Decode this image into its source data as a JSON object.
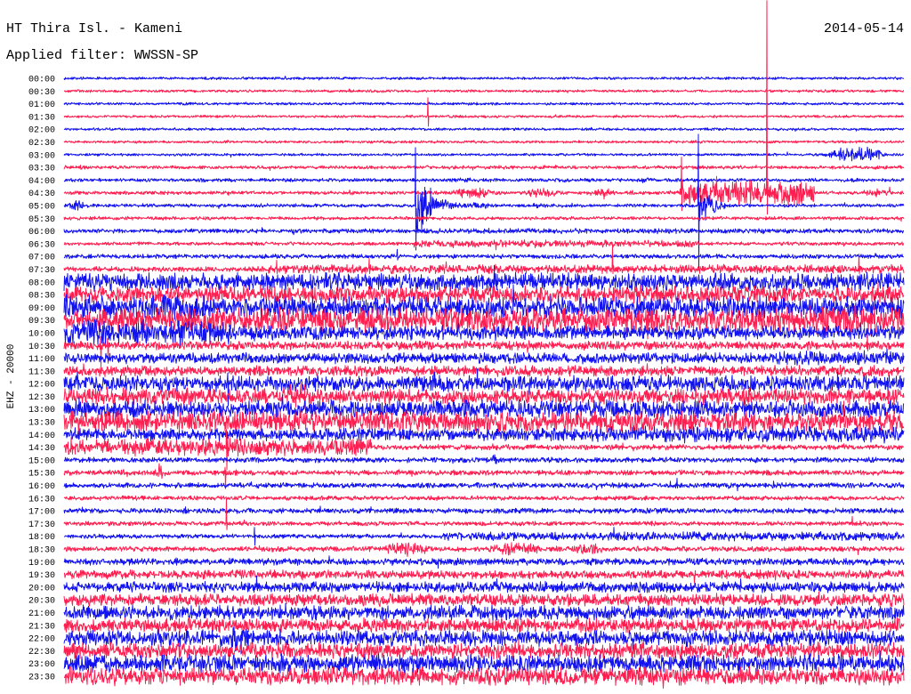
{
  "chart_data": {
    "type": "line",
    "title": "HT Thira Isl. - Kameni",
    "date": "2014-05-14",
    "subtitle": "Applied filter: WWSSN-SP",
    "ylabel": "EHZ - 20000",
    "xlim": [
      0,
      30
    ],
    "colors": [
      "#1212f0",
      "#ff1e50"
    ],
    "rows": [
      {
        "time": "00:00",
        "noise": 2100
      },
      {
        "time": "00:30",
        "noise": 2100
      },
      {
        "time": "01:00",
        "noise": 2100
      },
      {
        "time": "01:30",
        "noise": 2100,
        "events": [
          {
            "t": 13.0,
            "up": 29400,
            "down": 15400,
            "coda": 4200,
            "dur": 0.2
          }
        ]
      },
      {
        "time": "02:00",
        "noise": 2100
      },
      {
        "time": "02:30",
        "noise": 2100
      },
      {
        "time": "03:00",
        "noise": 2100,
        "packets": [
          {
            "from": 27.0,
            "to": 29.6,
            "amp": 12600
          }
        ]
      },
      {
        "time": "03:30",
        "noise": 2800,
        "packets": [
          {
            "from": 0.0,
            "to": 1.2,
            "amp": 4200
          }
        ]
      },
      {
        "time": "04:00",
        "noise": 2800,
        "packets": [
          {
            "from": 13.4,
            "to": 15.0,
            "amp": 4200
          },
          {
            "from": 20.3,
            "to": 21.3,
            "amp": 5600
          }
        ]
      },
      {
        "time": "04:30",
        "noise": 2800,
        "segments": [
          {
            "from": 22.0,
            "to": 26.8,
            "noise": 19600
          }
        ],
        "packets": [
          {
            "from": 13.3,
            "to": 15.8,
            "amp": 8400
          },
          {
            "from": 16.1,
            "to": 18.0,
            "amp": 7000
          },
          {
            "from": 18.4,
            "to": 20.0,
            "amp": 7000
          },
          {
            "from": 21.0,
            "to": 22.0,
            "amp": 4200
          },
          {
            "from": 28.2,
            "to": 29.9,
            "amp": 7000
          }
        ],
        "events": [
          {
            "t": 22.05,
            "up": 56000,
            "down": 28000,
            "coda": 28000,
            "dur": 0.6
          },
          {
            "t": 25.1,
            "up": 302000,
            "down": 33600,
            "coda": 14000,
            "dur": 0.2
          }
        ]
      },
      {
        "time": "05:00",
        "noise": 2800,
        "packets": [
          {
            "from": 0.0,
            "to": 1.0,
            "amp": 8400
          },
          {
            "from": 13.3,
            "to": 15.8,
            "amp": 5600
          },
          {
            "from": 16.1,
            "to": 18.0,
            "amp": 4200
          }
        ],
        "events": [
          {
            "t": 12.55,
            "up": 91000,
            "down": 70000,
            "coda": 63000,
            "dur": 1.7
          },
          {
            "t": 22.66,
            "up": 112000,
            "down": 98000,
            "coda": 56000,
            "dur": 1.2
          }
        ]
      },
      {
        "time": "05:30",
        "noise": 2800
      },
      {
        "time": "06:00",
        "noise": 3500,
        "segments": [
          {
            "from": 12.55,
            "to": 22.7,
            "noise": 4200
          }
        ]
      },
      {
        "time": "06:30",
        "noise": 2800,
        "segments": [
          {
            "from": 12.5,
            "to": 22.7,
            "noise": 5600
          }
        ]
      },
      {
        "time": "07:00",
        "noise": 3500,
        "events": [
          {
            "t": 11.9,
            "up": 11200,
            "down": 5600,
            "coda": 4200,
            "dur": 0.2
          }
        ]
      },
      {
        "time": "07:30",
        "noise": 7000,
        "segments": [
          {
            "from": 0.0,
            "to": 7.3,
            "noise": 4200
          }
        ],
        "events": [
          {
            "t": 7.6,
            "up": 14000,
            "down": 7000,
            "coda": 8400,
            "dur": 0.2
          },
          {
            "t": 10.9,
            "up": 16800,
            "down": 7000,
            "coda": 8400,
            "dur": 0.2
          },
          {
            "t": 19.6,
            "up": 37800,
            "down": 7000,
            "coda": 8400,
            "dur": 0.2
          },
          {
            "t": 28.4,
            "up": 23800,
            "down": 7000,
            "coda": 8400,
            "dur": 0.2
          }
        ]
      },
      {
        "time": "08:00",
        "noise": 14000
      },
      {
        "time": "08:30",
        "noise": 14000
      },
      {
        "time": "09:00",
        "noise": 16800,
        "segments": [
          {
            "from": 0.0,
            "to": 5.0,
            "noise": 19600
          }
        ]
      },
      {
        "time": "09:30",
        "noise": 19600,
        "segments": [
          {
            "from": 0.0,
            "to": 1.2,
            "noise": 14000
          },
          {
            "from": 26.6,
            "to": 30.0,
            "noise": 25200
          }
        ]
      },
      {
        "time": "10:00",
        "noise": 11200,
        "segments": [
          {
            "from": 0.0,
            "to": 6.0,
            "noise": 19600
          }
        ]
      },
      {
        "time": "10:30",
        "noise": 7000,
        "events": [
          {
            "t": 1.3,
            "up": 14000,
            "down": 33600,
            "coda": 7000,
            "dur": 0.1
          },
          {
            "t": 1.55,
            "up": 11200,
            "down": 28000,
            "coda": 7000,
            "dur": 0.1
          },
          {
            "t": 28.7,
            "up": 16800,
            "down": 8400,
            "coda": 7000,
            "dur": 0.1
          }
        ]
      },
      {
        "time": "11:00",
        "noise": 8400,
        "segments": [
          {
            "from": 25.5,
            "to": 30.0,
            "noise": 11200
          }
        ]
      },
      {
        "time": "11:30",
        "noise": 8400
      },
      {
        "time": "12:00",
        "noise": 12600,
        "events": [
          {
            "t": 5.85,
            "up": 16800,
            "down": 35000,
            "coda": 12600,
            "dur": 0.2
          }
        ]
      },
      {
        "time": "12:30",
        "noise": 12600,
        "packets": [
          {
            "from": 7.2,
            "to": 9.5,
            "amp": 19600
          }
        ]
      },
      {
        "time": "13:00",
        "noise": 14000
      },
      {
        "time": "13:30",
        "noise": 16800
      },
      {
        "time": "14:00",
        "noise": 9800,
        "segments": [
          {
            "from": 19.0,
            "to": 30.0,
            "noise": 12600
          }
        ]
      },
      {
        "time": "14:30",
        "noise": 14000,
        "segments": [
          {
            "from": 11.0,
            "to": 30.0,
            "noise": 4200
          }
        ],
        "events": [
          {
            "t": 5.8,
            "up": 28000,
            "down": 35000,
            "coda": 25200,
            "dur": 0.5
          }
        ]
      },
      {
        "time": "15:00",
        "noise": 4200,
        "packets": [
          {
            "from": 15.1,
            "to": 15.7,
            "amp": 8400
          }
        ]
      },
      {
        "time": "15:30",
        "noise": 4200,
        "packets": [
          {
            "from": 3.1,
            "to": 3.7,
            "amp": 14000
          }
        ],
        "events": [
          {
            "t": 5.75,
            "up": 8400,
            "down": 25200,
            "coda": 11200,
            "dur": 0.4
          }
        ]
      },
      {
        "time": "16:00",
        "noise": 4200,
        "events": [
          {
            "t": 21.9,
            "up": 11200,
            "down": 4200,
            "coda": 2800,
            "dur": 0.1
          }
        ]
      },
      {
        "time": "16:30",
        "noise": 3500
      },
      {
        "time": "17:00",
        "noise": 4200
      },
      {
        "time": "17:30",
        "noise": 3500,
        "events": [
          {
            "t": 5.8,
            "up": 39200,
            "down": 9800,
            "coda": 4200,
            "dur": 0.1
          },
          {
            "t": 28.15,
            "up": 11200,
            "down": 2800,
            "coda": 1400,
            "dur": 0.05
          }
        ]
      },
      {
        "time": "18:00",
        "noise": 3500,
        "segments": [
          {
            "from": 13.5,
            "to": 30.0,
            "noise": 7000
          }
        ],
        "events": [
          {
            "t": 6.8,
            "up": 14000,
            "down": 14000,
            "coda": 7000,
            "dur": 0.3
          }
        ]
      },
      {
        "time": "18:30",
        "noise": 4200,
        "packets": [
          {
            "from": 11.0,
            "to": 13.5,
            "amp": 11200
          },
          {
            "from": 14.8,
            "to": 17.5,
            "amp": 11200
          },
          {
            "from": 17.8,
            "to": 19.6,
            "amp": 9800
          }
        ]
      },
      {
        "time": "19:00",
        "noise": 5600
      },
      {
        "time": "19:30",
        "noise": 7000
      },
      {
        "time": "20:00",
        "noise": 8400
      },
      {
        "time": "20:30",
        "noise": 9800
      },
      {
        "time": "21:00",
        "noise": 11200
      },
      {
        "time": "21:30",
        "noise": 11200
      },
      {
        "time": "22:00",
        "noise": 12600,
        "packets": [
          {
            "from": 5.6,
            "to": 7.0,
            "amp": 25200
          }
        ]
      },
      {
        "time": "22:30",
        "noise": 12600
      },
      {
        "time": "23:00",
        "noise": 14000
      },
      {
        "time": "23:30",
        "noise": 14000
      }
    ]
  }
}
